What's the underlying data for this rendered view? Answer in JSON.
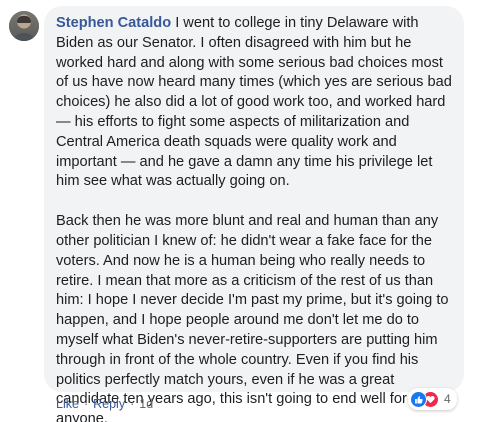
{
  "comment": {
    "author": "Stephen Cataldo",
    "paragraphs": [
      "I went to college in tiny Delaware with Biden as our Senator. I often disagreed with him but he worked hard and along with some serious bad choices most of us have now heard many times (which yes are serious bad choices) he also did a lot of good work too, and worked hard — his efforts to fight some aspects of militarization and Central America death squads were quality work and important — and he gave a damn any time his privilege let him see what was actually going on.",
      "Back then he was more blunt and real and human than any other politician I knew of: he didn't wear a fake face for the voters. And now he is a human being who really needs to retire. I mean that more as a criticism of the rest of us than him: I hope I never decide I'm past my prime, but it's going to happen, and I hope people around me don't let me do to myself what Biden's never-retire-supporters are putting him through in front of the whole country. Even if you find his politics perfectly match yours, even if he was a great candidate ten years ago, this isn't going to end well for anyone."
    ]
  },
  "reactions": {
    "icons": [
      "like-icon",
      "love-icon"
    ],
    "count": "4",
    "like_color": "#1877f2",
    "love_color": "#f0284a"
  },
  "actions": {
    "like_label": "Like",
    "separator": "·",
    "reply_label": "Reply",
    "timestamp": "1d"
  },
  "colors": {
    "author": "#385898",
    "bubble": "#f2f3f5",
    "text": "#1c1e21",
    "meta": "#65676b"
  }
}
